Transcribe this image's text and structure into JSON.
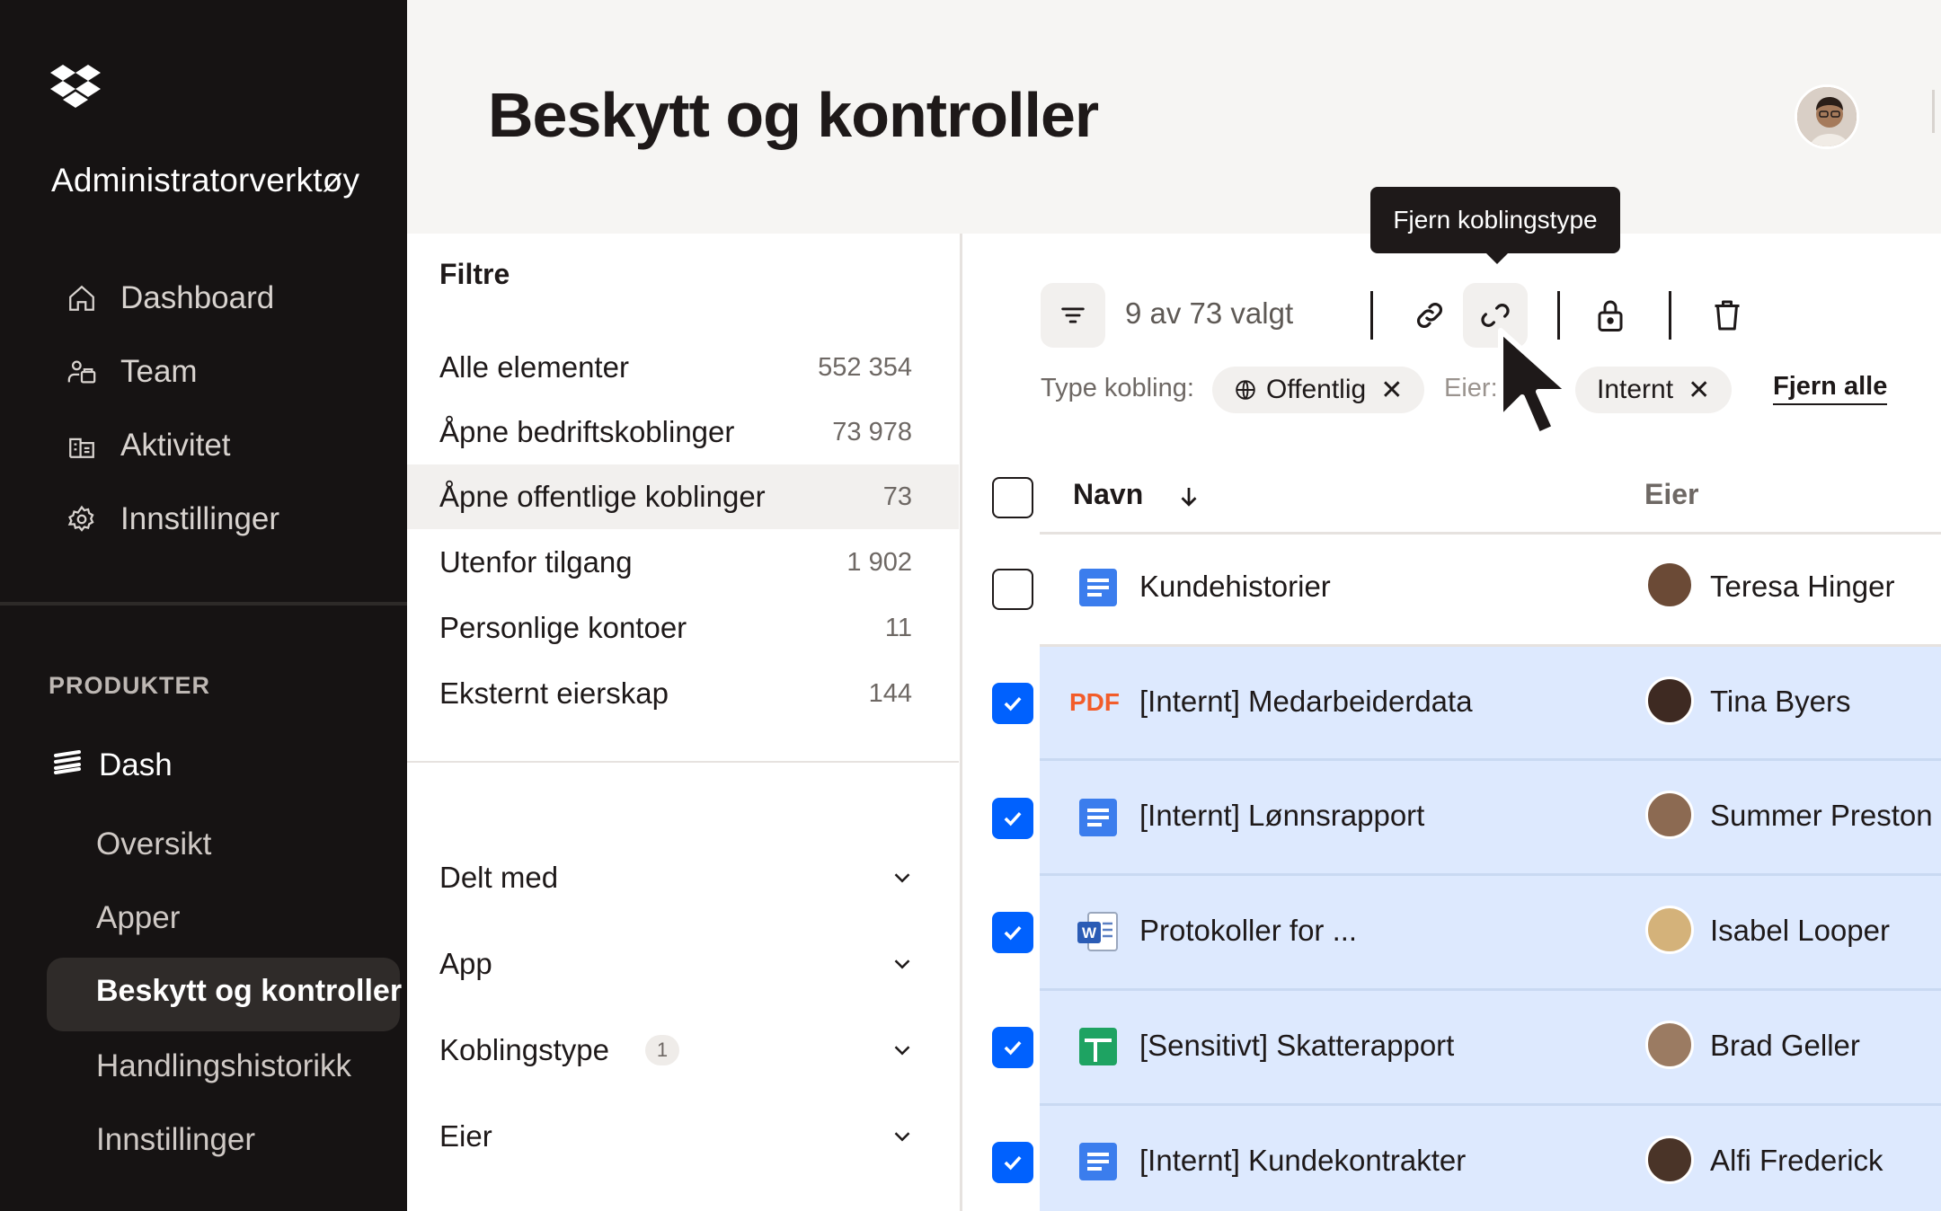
{
  "app": {
    "title": "Administratorverktøy"
  },
  "sidebar": {
    "nav": [
      {
        "label": "Dashboard",
        "icon": "home-icon"
      },
      {
        "label": "Team",
        "icon": "team-icon"
      },
      {
        "label": "Aktivitet",
        "icon": "activity-icon"
      },
      {
        "label": "Innstillinger",
        "icon": "gear-icon"
      }
    ],
    "section_label": "PRODUKTER",
    "product": {
      "label": "Dash",
      "icon": "dash-icon"
    },
    "sub_items": [
      "Oversikt",
      "Apper",
      "Beskytt og kontroller",
      "Handlingshistorikk",
      "Innstillinger"
    ],
    "active_sub": "Beskytt og kontroller"
  },
  "header": {
    "title": "Beskytt og kontroller"
  },
  "filters": {
    "heading": "Filtre",
    "rows": [
      {
        "label": "Alle elementer",
        "count": "552 354"
      },
      {
        "label": "Åpne bedriftskoblinger",
        "count": "73 978"
      },
      {
        "label": "Åpne offentlige koblinger",
        "count": "73"
      },
      {
        "label": "Utenfor tilgang",
        "count": "1 902"
      },
      {
        "label": "Personlige kontoer",
        "count": "11"
      },
      {
        "label": "Eksternt eierskap",
        "count": "144"
      }
    ],
    "active_index": 2,
    "dropdowns": [
      {
        "label": "Delt med",
        "badge": ""
      },
      {
        "label": "App",
        "badge": ""
      },
      {
        "label": "Koblingstype",
        "badge": "1"
      },
      {
        "label": "Eier",
        "badge": ""
      }
    ]
  },
  "toolbar": {
    "selection": "9 av 73 valgt",
    "tooltip": "Fjern koblingstype",
    "chips_label": "Type kobling:",
    "chips": [
      {
        "label": "Offentlig",
        "icon": "globe-icon"
      },
      {
        "label": "Internt",
        "icon": ""
      }
    ],
    "eier_truncated": "Eier:",
    "clear_all": "Fjern alle"
  },
  "table": {
    "columns": {
      "name": "Navn",
      "owner": "Eier"
    },
    "rows": [
      {
        "name": "Kundehistorier",
        "type": "doc",
        "owner": "Teresa Hinger",
        "selected": false,
        "avatar_color": "#6b4a36"
      },
      {
        "name": "[Internt] Medarbeiderdata",
        "type": "pdf",
        "type_label": "PDF",
        "owner": "Tina Byers",
        "selected": true,
        "avatar_color": "#3e2a22"
      },
      {
        "name": "[Internt] Lønnsrapport",
        "type": "doc",
        "owner": "Summer Preston",
        "selected": true,
        "avatar_color": "#8c6a52"
      },
      {
        "name": "Protokoller for ...",
        "type": "word",
        "owner": "Isabel Looper",
        "selected": true,
        "avatar_color": "#d4b27a"
      },
      {
        "name": "[Sensitivt] Skatterapport",
        "type": "sheet",
        "owner": "Brad Geller",
        "selected": true,
        "avatar_color": "#9b7b62"
      },
      {
        "name": "[Internt] Kundekontrakter",
        "type": "doc",
        "owner": "Alfi Frederick",
        "selected": true,
        "avatar_color": "#4a3428"
      }
    ]
  },
  "colors": {
    "accent": "#0061fe",
    "sidebar_bg": "#161313",
    "row_selected": "#dde9fe"
  }
}
